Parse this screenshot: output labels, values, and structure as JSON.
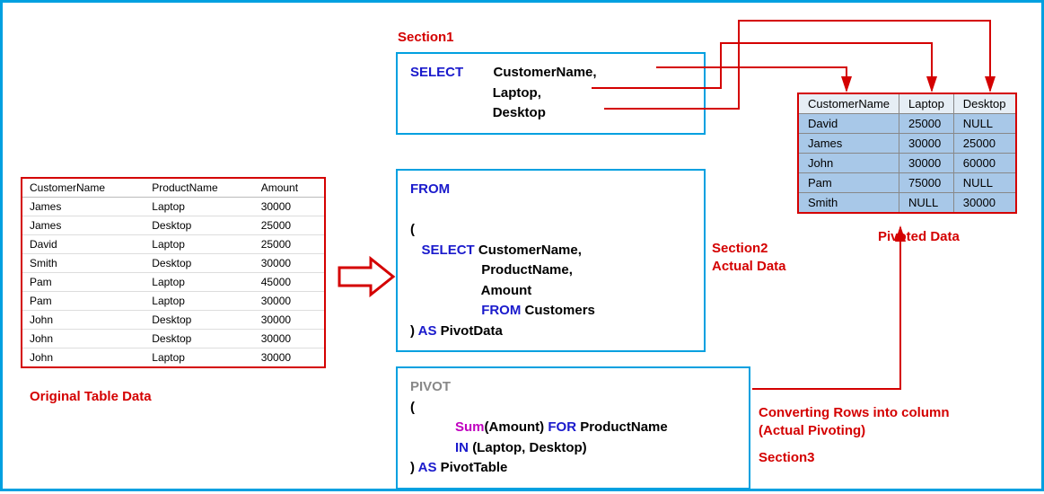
{
  "labels": {
    "original": "Original Table Data",
    "section1": "Section1",
    "section2a": "Section2",
    "section2b": "Actual Data",
    "section3a": "Converting Rows into column",
    "section3b": "(Actual Pivoting)",
    "section3c": "Section3",
    "pivoted": "Pivoted Data"
  },
  "orig": {
    "h1": "CustomerName",
    "h2": "ProductName",
    "h3": "Amount",
    "rows": [
      {
        "c": "James",
        "p": "Laptop",
        "a": "30000"
      },
      {
        "c": "James",
        "p": "Desktop",
        "a": "25000"
      },
      {
        "c": "David",
        "p": "Laptop",
        "a": "25000"
      },
      {
        "c": "Smith",
        "p": "Desktop",
        "a": "30000"
      },
      {
        "c": "Pam",
        "p": "Laptop",
        "a": "45000"
      },
      {
        "c": "Pam",
        "p": "Laptop",
        "a": "30000"
      },
      {
        "c": "John",
        "p": "Desktop",
        "a": "30000"
      },
      {
        "c": "John",
        "p": "Desktop",
        "a": "30000"
      },
      {
        "c": "John",
        "p": "Laptop",
        "a": "30000"
      }
    ]
  },
  "sql1": {
    "select": "SELECT",
    "col1": "CustomerName",
    "col2": "Laptop",
    "col3": "Desktop"
  },
  "sql2": {
    "from": "FROM",
    "open": "(",
    "select": "SELECT",
    "col1": "CustomerName",
    "col2": "ProductName",
    "col3": "Amount",
    "from2": "FROM",
    "tbl": "Customers",
    "close": ")",
    "as": "AS",
    "alias": "PivotData"
  },
  "sql3": {
    "pivot": "PIVOT",
    "open": "(",
    "sum": "Sum",
    "sumarg": "(Amount)",
    "for": "FOR",
    "forcol": "ProductName",
    "in": "IN",
    "inlist": "(Laptop, Desktop)",
    "close": ")",
    "as": "AS",
    "alias": "PivotTable"
  },
  "pivot": {
    "h1": "CustomerName",
    "h2": "Laptop",
    "h3": "Desktop",
    "rows": [
      {
        "c": "David",
        "l": "25000",
        "d": "NULL"
      },
      {
        "c": "James",
        "l": "30000",
        "d": "25000"
      },
      {
        "c": "John",
        "l": "30000",
        "d": "60000"
      },
      {
        "c": "Pam",
        "l": "75000",
        "d": "NULL"
      },
      {
        "c": "Smith",
        "l": "NULL",
        "d": "30000"
      }
    ]
  }
}
